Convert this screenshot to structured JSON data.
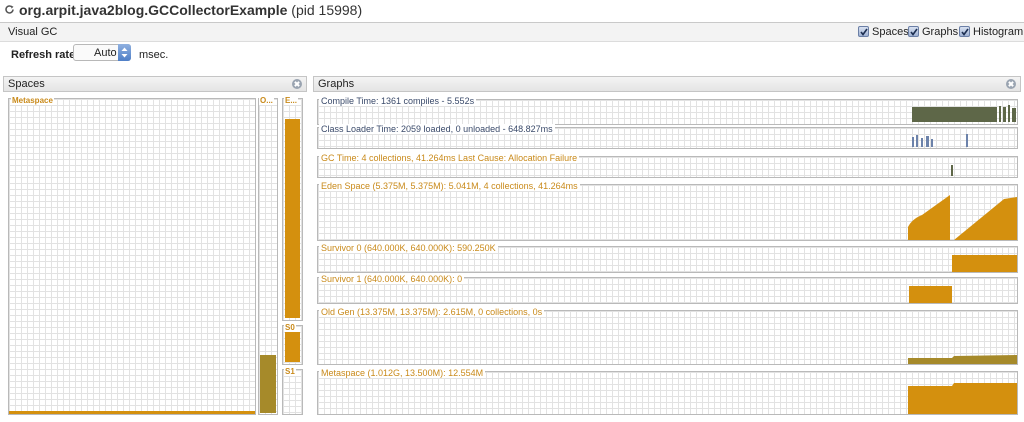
{
  "window": {
    "title": "org.arpit.java2blog.GCCollectorExample",
    "pid": "(pid 15998)"
  },
  "toolbar": {
    "tab_label": "Visual GC",
    "checkboxes": [
      {
        "label": "Spaces",
        "checked": true
      },
      {
        "label": "Graphs",
        "checked": true
      },
      {
        "label": "Histogram",
        "checked": true
      }
    ]
  },
  "refresh": {
    "label": "Refresh rate:",
    "value": "Auto",
    "unit": "msec."
  },
  "spaces_panel": {
    "title": "Spaces",
    "columns": [
      {
        "label": "Metaspace",
        "fill": 0.01
      },
      {
        "label": "O...",
        "fill": 0.2
      },
      {
        "label": "E...",
        "fill": 0.94
      },
      {
        "label": "S0",
        "fill": 0.92
      },
      {
        "label": "S1",
        "fill": 0.0
      }
    ]
  },
  "graphs_panel": {
    "title": "Graphs",
    "graphs": [
      {
        "label": "Compile Time: 1361 compiles - 5.552s"
      },
      {
        "label": "Class Loader Time: 2059 loaded, 0 unloaded - 648.827ms"
      },
      {
        "label": "GC Time: 4 collections, 41.264ms Last Cause: Allocation Failure"
      },
      {
        "label": "Eden Space (5.375M, 5.375M): 5.041M, 4 collections, 41.264ms"
      },
      {
        "label": "Survivor 0 (640.000K, 640.000K): 590.250K"
      },
      {
        "label": "Survivor 1 (640.000K, 640.000K): 0"
      },
      {
        "label": "Old Gen (13.375M, 13.375M): 2.615M, 0 collections, 0s"
      },
      {
        "label": "Metaspace (1.012G, 13.500M): 12.554M"
      }
    ]
  },
  "colors": {
    "space_fill": "#d4900e",
    "old_fill": "#a68a2a",
    "compile_fill": "#5e6748",
    "classloader_fill": "#6c82aa",
    "label_orange": "#c98a1a"
  }
}
